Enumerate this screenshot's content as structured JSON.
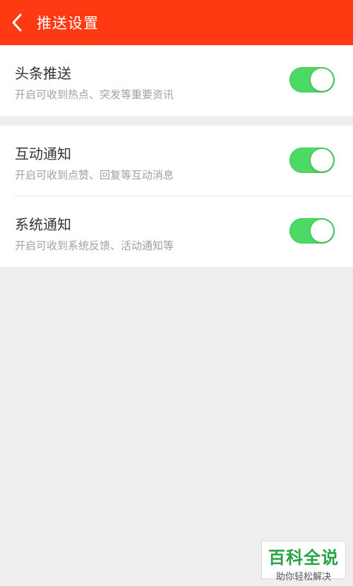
{
  "header": {
    "title": "推送设置",
    "back_icon": "chevron-left-icon",
    "background_color": "#ff3a12"
  },
  "sections": [
    {
      "items": [
        {
          "title": "头条推送",
          "subtitle": "开启可收到热点、突发等重要资讯",
          "enabled": true
        }
      ]
    },
    {
      "items": [
        {
          "title": "互动通知",
          "subtitle": "开启可收到点赞、回复等互动消息",
          "enabled": true
        },
        {
          "title": "系统通知",
          "subtitle": "开启可收到系统反馈、活动通知等",
          "enabled": true
        }
      ]
    }
  ],
  "toggle_on_color": "#4cd964",
  "watermark": {
    "title": "百科全说",
    "subtitle": "助你轻松解决",
    "color": "#27a344"
  }
}
